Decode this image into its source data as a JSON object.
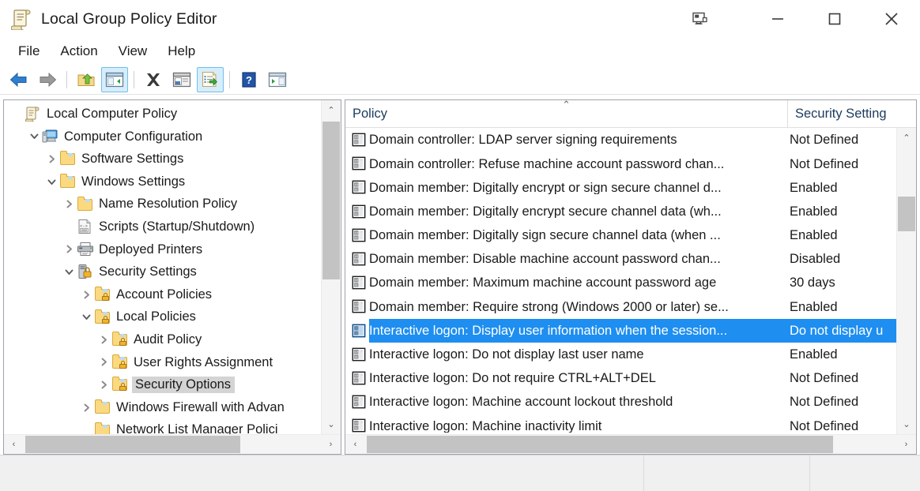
{
  "window": {
    "title": "Local Group Policy Editor",
    "title_icon": "policy-scroll-icon",
    "buttons": {
      "display_icon": "display-monitor-icon",
      "minimize": "—",
      "maximize": "☐",
      "close": "✕"
    }
  },
  "menubar": {
    "items": [
      {
        "label": "File"
      },
      {
        "label": "Action"
      },
      {
        "label": "View"
      },
      {
        "label": "Help"
      }
    ]
  },
  "toolbar": {
    "items": [
      {
        "name": "back-button",
        "icon": "back-arrow-icon",
        "active": false
      },
      {
        "name": "forward-button",
        "icon": "forward-arrow-icon",
        "active": false
      },
      {
        "name": "separator-1",
        "icon": "separator",
        "active": false
      },
      {
        "name": "up-one-level-button",
        "icon": "folder-up-icon",
        "active": false
      },
      {
        "name": "show-hide-console-tree-button",
        "icon": "console-tree-icon",
        "active": true
      },
      {
        "name": "separator-2",
        "icon": "separator",
        "active": false
      },
      {
        "name": "delete-button",
        "icon": "delete-x-icon",
        "active": false
      },
      {
        "name": "properties-button",
        "icon": "properties-icon",
        "active": false
      },
      {
        "name": "export-list-button",
        "icon": "export-list-icon",
        "active": true
      },
      {
        "name": "separator-3",
        "icon": "separator",
        "active": false
      },
      {
        "name": "help-button",
        "icon": "help-question-icon",
        "active": false
      },
      {
        "name": "show-action-pane-button",
        "icon": "action-pane-icon",
        "active": false
      }
    ]
  },
  "tree": {
    "nodes": [
      {
        "label": "Local Computer Policy",
        "indent": 0,
        "chevron": "none",
        "icon": "policy-scroll-icon",
        "selected": false
      },
      {
        "label": "Computer Configuration",
        "indent": 1,
        "chevron": "down",
        "icon": "computer-icon",
        "selected": false
      },
      {
        "label": "Software Settings",
        "indent": 2,
        "chevron": "right",
        "icon": "folder-icon",
        "selected": false
      },
      {
        "label": "Windows Settings",
        "indent": 2,
        "chevron": "down",
        "icon": "folder-icon",
        "selected": false
      },
      {
        "label": "Name Resolution Policy",
        "indent": 3,
        "chevron": "right",
        "icon": "folder-icon",
        "selected": false
      },
      {
        "label": "Scripts (Startup/Shutdown)",
        "indent": 3,
        "chevron": "none",
        "icon": "script-icon",
        "selected": false
      },
      {
        "label": "Deployed Printers",
        "indent": 3,
        "chevron": "right",
        "icon": "printer-icon",
        "selected": false
      },
      {
        "label": "Security Settings",
        "indent": 3,
        "chevron": "down",
        "icon": "security-lock-icon",
        "selected": false
      },
      {
        "label": "Account Policies",
        "indent": 4,
        "chevron": "right",
        "icon": "folder-lock-icon",
        "selected": false
      },
      {
        "label": "Local Policies",
        "indent": 4,
        "chevron": "down",
        "icon": "folder-lock-icon",
        "selected": false
      },
      {
        "label": "Audit Policy",
        "indent": 5,
        "chevron": "right",
        "icon": "folder-lock-icon",
        "selected": false
      },
      {
        "label": "User Rights Assignment",
        "indent": 5,
        "chevron": "right",
        "icon": "folder-lock-icon",
        "selected": false
      },
      {
        "label": "Security Options",
        "indent": 5,
        "chevron": "right",
        "icon": "folder-lock-icon",
        "selected": true
      },
      {
        "label": "Windows Firewall with Advan",
        "indent": 4,
        "chevron": "right",
        "icon": "folder-icon",
        "selected": false
      },
      {
        "label": "Network List Manager Polici",
        "indent": 4,
        "chevron": "none",
        "icon": "folder-icon",
        "selected": false
      }
    ],
    "scroll": {
      "up_arrow": "⌃",
      "down_arrow": "⌄",
      "left_arrow": "‹",
      "right_arrow": "›"
    }
  },
  "list": {
    "columns": [
      {
        "label": "Policy",
        "sort": "ascending",
        "sort_mark": "⌃"
      },
      {
        "label": "Security Setting",
        "sort": "none",
        "sort_mark": ""
      }
    ],
    "rows": [
      {
        "policy": "Domain controller: LDAP server signing requirements",
        "setting": "Not Defined",
        "selected": false
      },
      {
        "policy": "Domain controller: Refuse machine account password chan...",
        "setting": "Not Defined",
        "selected": false
      },
      {
        "policy": "Domain member: Digitally encrypt or sign secure channel d...",
        "setting": "Enabled",
        "selected": false
      },
      {
        "policy": "Domain member: Digitally encrypt secure channel data (wh...",
        "setting": "Enabled",
        "selected": false
      },
      {
        "policy": "Domain member: Digitally sign secure channel data (when ...",
        "setting": "Enabled",
        "selected": false
      },
      {
        "policy": "Domain member: Disable machine account password chan...",
        "setting": "Disabled",
        "selected": false
      },
      {
        "policy": "Domain member: Maximum machine account password age",
        "setting": "30 days",
        "selected": false
      },
      {
        "policy": "Domain member: Require strong (Windows 2000 or later) se...",
        "setting": "Enabled",
        "selected": false
      },
      {
        "policy": "Interactive logon: Display user information when the session...",
        "setting": "Do not display u",
        "selected": true
      },
      {
        "policy": "Interactive logon: Do not display last user name",
        "setting": "Enabled",
        "selected": false
      },
      {
        "policy": "Interactive logon: Do not require CTRL+ALT+DEL",
        "setting": "Not Defined",
        "selected": false
      },
      {
        "policy": "Interactive logon: Machine account lockout threshold",
        "setting": "Not Defined",
        "selected": false
      },
      {
        "policy": "Interactive logon: Machine inactivity limit",
        "setting": "Not Defined",
        "selected": false
      }
    ],
    "scroll": {
      "up_arrow": "⌃",
      "down_arrow": "⌄",
      "left_arrow": "‹",
      "right_arrow": "›"
    }
  },
  "statusbar": {
    "left": "",
    "middle": "",
    "right": ""
  },
  "colors": {
    "selection_blue": "#1e8ef0",
    "tree_selection_gray": "#d4d4d4",
    "toolbar_active_bg": "#d8edfb",
    "toolbar_active_border": "#6ec0ed",
    "header_text": "#1b3a5c",
    "pane_border": "#9fa3a8",
    "scrollbar_thumb": "#c3c3c3",
    "statusbar_bg": "#f0f0f0"
  }
}
